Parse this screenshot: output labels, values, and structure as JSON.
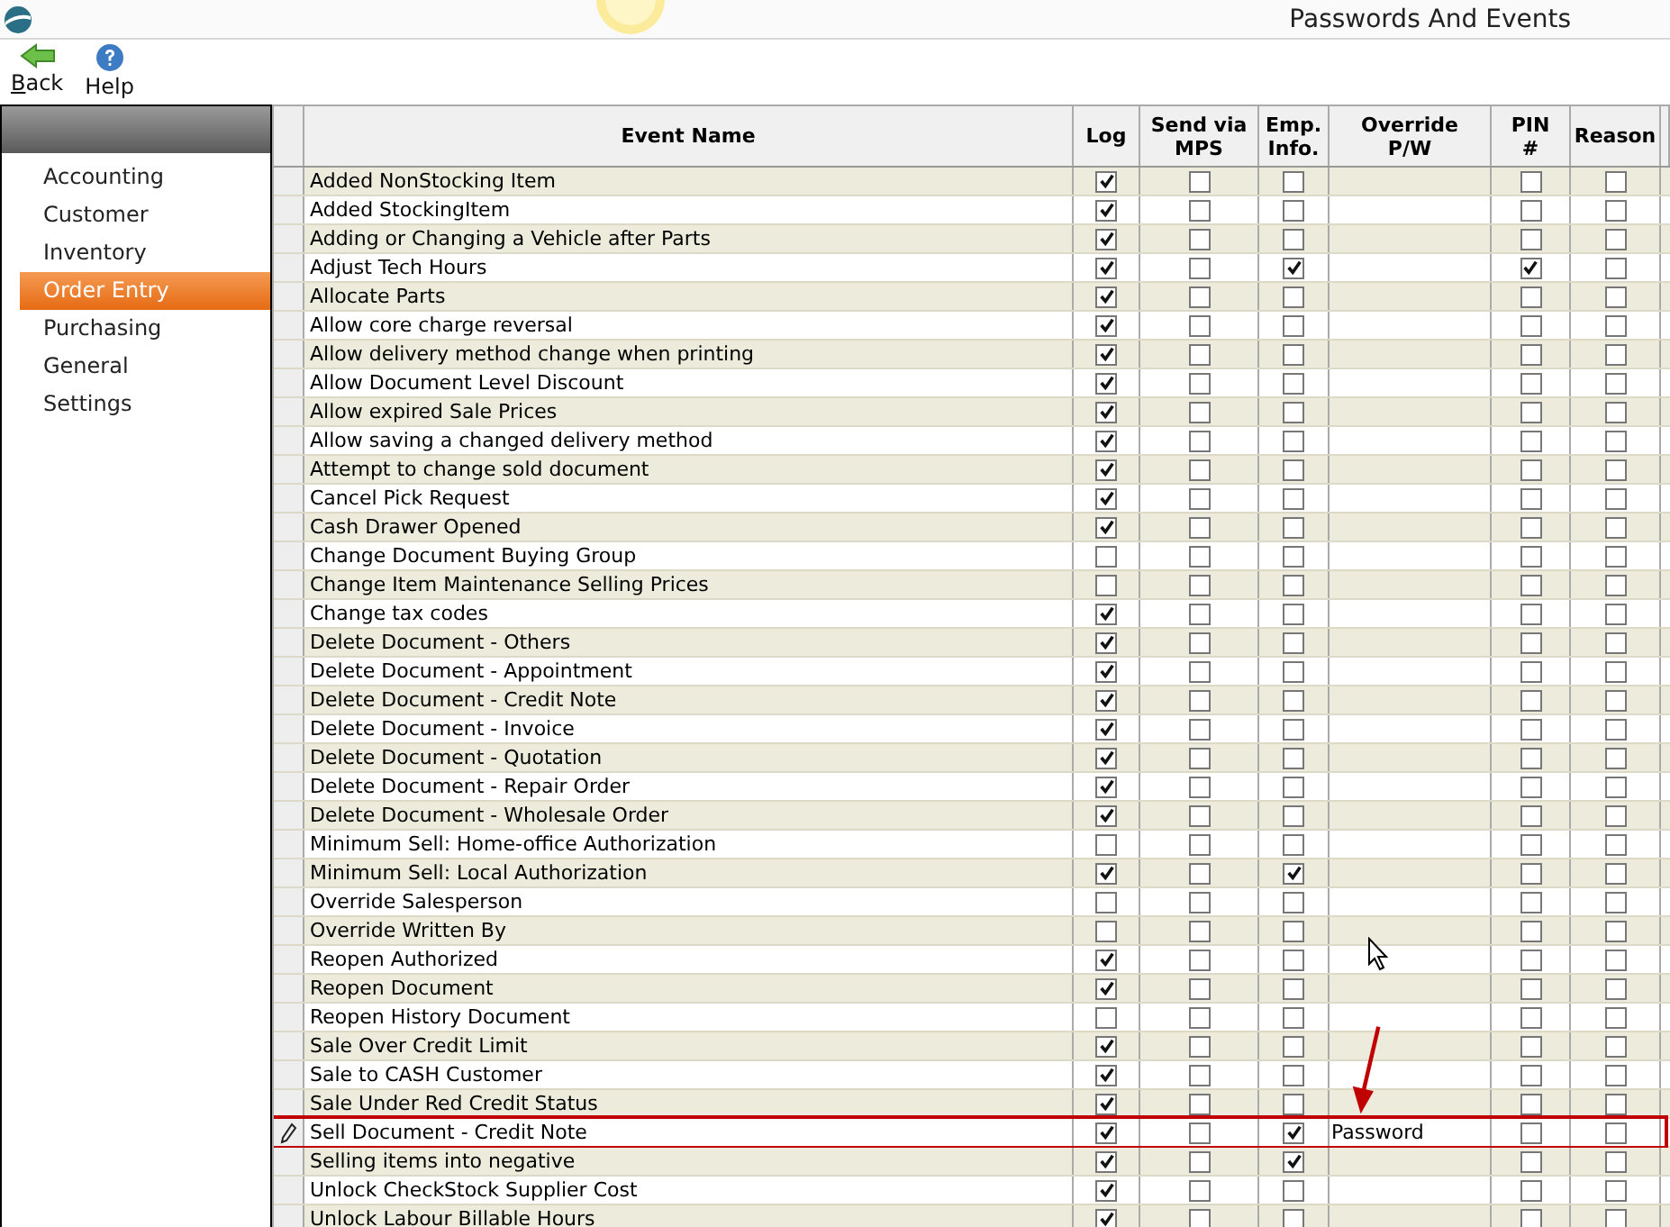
{
  "window": {
    "title": "Passwords And Events"
  },
  "toolbar": [
    {
      "kind": "back",
      "label": "Back"
    },
    {
      "kind": "help",
      "label": "Help"
    }
  ],
  "sidebar": {
    "items": [
      {
        "label": "Accounting",
        "selected": false
      },
      {
        "label": "Customer",
        "selected": false
      },
      {
        "label": "Inventory",
        "selected": false
      },
      {
        "label": "Order Entry",
        "selected": true
      },
      {
        "label": "Purchasing",
        "selected": false
      },
      {
        "label": "General",
        "selected": false
      },
      {
        "label": "Settings",
        "selected": false
      }
    ]
  },
  "table": {
    "columns": [
      "Event Name",
      "Log",
      "Send via\nMPS",
      "Emp.\nInfo.",
      "Override\nP/W",
      "PIN\n#",
      "Reason"
    ],
    "rows": [
      {
        "name": "Added NonStocking Item",
        "log": true,
        "mps": false,
        "emp": false,
        "override": "",
        "pin": false,
        "reason": false,
        "editing": false
      },
      {
        "name": "Added StockingItem",
        "log": true,
        "mps": false,
        "emp": false,
        "override": "",
        "pin": false,
        "reason": false,
        "editing": false
      },
      {
        "name": "Adding or Changing a Vehicle after Parts",
        "log": true,
        "mps": false,
        "emp": false,
        "override": "",
        "pin": false,
        "reason": false,
        "editing": false
      },
      {
        "name": "Adjust Tech Hours",
        "log": true,
        "mps": false,
        "emp": true,
        "override": "",
        "pin": true,
        "reason": false,
        "editing": false
      },
      {
        "name": "Allocate Parts",
        "log": true,
        "mps": false,
        "emp": false,
        "override": "",
        "pin": false,
        "reason": false,
        "editing": false
      },
      {
        "name": "Allow core charge reversal",
        "log": true,
        "mps": false,
        "emp": false,
        "override": "",
        "pin": false,
        "reason": false,
        "editing": false
      },
      {
        "name": "Allow delivery method change when printing",
        "log": true,
        "mps": false,
        "emp": false,
        "override": "",
        "pin": false,
        "reason": false,
        "editing": false
      },
      {
        "name": "Allow Document Level Discount",
        "log": true,
        "mps": false,
        "emp": false,
        "override": "",
        "pin": false,
        "reason": false,
        "editing": false
      },
      {
        "name": "Allow expired Sale Prices",
        "log": true,
        "mps": false,
        "emp": false,
        "override": "",
        "pin": false,
        "reason": false,
        "editing": false
      },
      {
        "name": "Allow saving a changed delivery method",
        "log": true,
        "mps": false,
        "emp": false,
        "override": "",
        "pin": false,
        "reason": false,
        "editing": false
      },
      {
        "name": "Attempt to change sold document",
        "log": true,
        "mps": false,
        "emp": false,
        "override": "",
        "pin": false,
        "reason": false,
        "editing": false
      },
      {
        "name": "Cancel Pick Request",
        "log": true,
        "mps": false,
        "emp": false,
        "override": "",
        "pin": false,
        "reason": false,
        "editing": false
      },
      {
        "name": "Cash Drawer Opened",
        "log": true,
        "mps": false,
        "emp": false,
        "override": "",
        "pin": false,
        "reason": false,
        "editing": false
      },
      {
        "name": "Change Document Buying Group",
        "log": false,
        "mps": false,
        "emp": false,
        "override": "",
        "pin": false,
        "reason": false,
        "editing": false
      },
      {
        "name": "Change Item Maintenance Selling Prices",
        "log": false,
        "mps": false,
        "emp": false,
        "override": "",
        "pin": false,
        "reason": false,
        "editing": false
      },
      {
        "name": "Change tax codes",
        "log": true,
        "mps": false,
        "emp": false,
        "override": "",
        "pin": false,
        "reason": false,
        "editing": false
      },
      {
        "name": "Delete Document -  Others",
        "log": true,
        "mps": false,
        "emp": false,
        "override": "",
        "pin": false,
        "reason": false,
        "editing": false
      },
      {
        "name": "Delete Document - Appointment",
        "log": true,
        "mps": false,
        "emp": false,
        "override": "",
        "pin": false,
        "reason": false,
        "editing": false
      },
      {
        "name": "Delete Document - Credit Note",
        "log": true,
        "mps": false,
        "emp": false,
        "override": "",
        "pin": false,
        "reason": false,
        "editing": false
      },
      {
        "name": "Delete Document - Invoice",
        "log": true,
        "mps": false,
        "emp": false,
        "override": "",
        "pin": false,
        "reason": false,
        "editing": false
      },
      {
        "name": "Delete Document - Quotation",
        "log": true,
        "mps": false,
        "emp": false,
        "override": "",
        "pin": false,
        "reason": false,
        "editing": false
      },
      {
        "name": "Delete Document - Repair Order",
        "log": true,
        "mps": false,
        "emp": false,
        "override": "",
        "pin": false,
        "reason": false,
        "editing": false
      },
      {
        "name": "Delete Document - Wholesale Order",
        "log": true,
        "mps": false,
        "emp": false,
        "override": "",
        "pin": false,
        "reason": false,
        "editing": false
      },
      {
        "name": "Minimum Sell: Home-office Authorization",
        "log": false,
        "mps": false,
        "emp": false,
        "override": "",
        "pin": false,
        "reason": false,
        "editing": false
      },
      {
        "name": "Minimum Sell: Local Authorization",
        "log": true,
        "mps": false,
        "emp": true,
        "override": "",
        "pin": false,
        "reason": false,
        "editing": false
      },
      {
        "name": "Override Salesperson",
        "log": false,
        "mps": false,
        "emp": false,
        "override": "",
        "pin": false,
        "reason": false,
        "editing": false
      },
      {
        "name": "Override Written By",
        "log": false,
        "mps": false,
        "emp": false,
        "override": "",
        "pin": false,
        "reason": false,
        "editing": false
      },
      {
        "name": "Reopen Authorized",
        "log": true,
        "mps": false,
        "emp": false,
        "override": "",
        "pin": false,
        "reason": false,
        "editing": false
      },
      {
        "name": "Reopen Document",
        "log": true,
        "mps": false,
        "emp": false,
        "override": "",
        "pin": false,
        "reason": false,
        "editing": false
      },
      {
        "name": "Reopen History Document",
        "log": false,
        "mps": false,
        "emp": false,
        "override": "",
        "pin": false,
        "reason": false,
        "editing": false
      },
      {
        "name": "Sale Over Credit Limit",
        "log": true,
        "mps": false,
        "emp": false,
        "override": "",
        "pin": false,
        "reason": false,
        "editing": false
      },
      {
        "name": "Sale to CASH Customer",
        "log": true,
        "mps": false,
        "emp": false,
        "override": "",
        "pin": false,
        "reason": false,
        "editing": false
      },
      {
        "name": "Sale Under Red Credit Status",
        "log": true,
        "mps": false,
        "emp": false,
        "override": "",
        "pin": false,
        "reason": false,
        "editing": false
      },
      {
        "name": "Sell Document - Credit Note",
        "log": true,
        "mps": false,
        "emp": true,
        "override": "Password",
        "pin": false,
        "reason": false,
        "editing": true
      },
      {
        "name": "Selling items into negative",
        "log": true,
        "mps": false,
        "emp": true,
        "override": "",
        "pin": false,
        "reason": false,
        "editing": false
      },
      {
        "name": "Unlock CheckStock Supplier Cost",
        "log": true,
        "mps": false,
        "emp": false,
        "override": "",
        "pin": false,
        "reason": false,
        "editing": false
      },
      {
        "name": "Unlock Labour Billable Hours",
        "log": true,
        "mps": false,
        "emp": false,
        "override": "",
        "pin": false,
        "reason": false,
        "editing": false
      }
    ]
  }
}
